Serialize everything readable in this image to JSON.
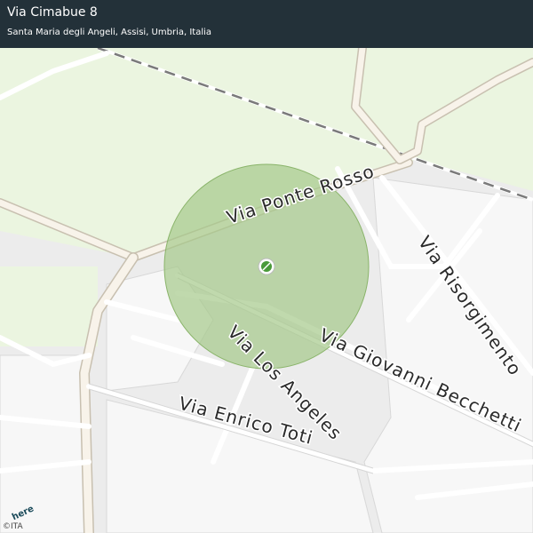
{
  "header": {
    "title": "Via Cimabue 8",
    "subtitle": "Santa Maria degli Angeli, Assisi, Umbria, Italia"
  },
  "map": {
    "marker_icon": "location-pin-icon",
    "accuracy_area_color": "#a5c98a",
    "street_labels": {
      "ponte_rosso": "Via Ponte Rosso",
      "risorgimento": "Via Risorgimento",
      "giovanni_becchetti": "Via Giovanni Becchetti",
      "los_angeles": "Via Los Angeles",
      "enrico_toti": "Via Enrico Toti"
    }
  },
  "attribution": {
    "copyright": "©ITA",
    "logo_text": "here"
  }
}
